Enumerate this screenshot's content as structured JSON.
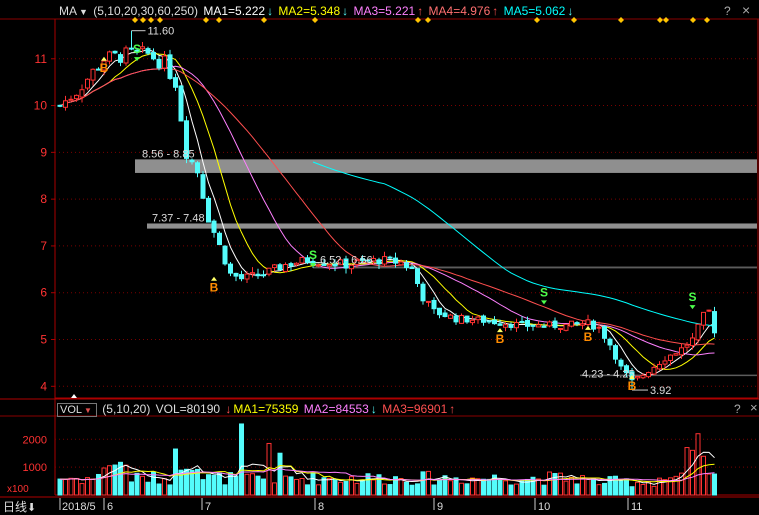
{
  "main_header": {
    "indicator": "MA",
    "dropdown": "▼",
    "params": "(5,10,20,30,60,250)",
    "ma1": "MA1=5.222",
    "ma1_arrow": "↓",
    "ma2": "MA2=5.348",
    "ma2_arrow": "↓",
    "ma3": "MA3=5.221",
    "ma3_arrow": "↑",
    "ma4": "MA4=4.976",
    "ma4_arrow": "↑",
    "ma5": "MA5=5.062",
    "ma5_arrow": "↓"
  },
  "vol_header": {
    "indicator": "VOL",
    "params": "(5,10,20)",
    "vol": "VOL=80190",
    "ma1": "MA1=75359",
    "ma1_arrow": "↓",
    "ma2": "MA2=84553",
    "ma2_arrow": "↓",
    "ma3": "MA3=96901",
    "ma3_arrow": "↑"
  },
  "window_buttons": {
    "help": "?",
    "close": "×"
  },
  "bottom_bar": {
    "period": "日线",
    "period_arrow": "⬇",
    "start_date": "2018/5"
  },
  "price_annotations": {
    "high": "11.60",
    "low": "3.92",
    "gap1": "8.56 - 8.85",
    "gap2": "7.37 - 7.48",
    "gap3": "6.52 - 6.56",
    "gap4": "4.23 - 4.25"
  },
  "signals": {
    "buy": "B",
    "sell": "S"
  },
  "vol_unit": "x100",
  "colors": {
    "up": "#ff3232",
    "down": "#54fcfc",
    "ma5": "#ffffff",
    "ma10": "#ffff00",
    "ma20": "#ff80ff",
    "ma30": "#ff4f4f",
    "ma60": "#00ffff",
    "grid": "#7a0000",
    "axis": "#aa0000",
    "buy": "#ff8c00",
    "sell": "#4cff4c",
    "diamond": "#ffc400",
    "gapband": "#a8a8a8"
  },
  "chart_data": {
    "type": "candlestick",
    "y_ticks": [
      "4",
      "5",
      "6",
      "7",
      "8",
      "9",
      "10",
      "11"
    ],
    "y_range": [
      3.75,
      11.85
    ],
    "vol_ticks": [
      "1000",
      "2000"
    ],
    "vol_range": [
      0,
      2800
    ],
    "x_ticks": [
      "6",
      "7",
      "8",
      "9",
      "10",
      "11"
    ],
    "first_date": "2018/5",
    "session_count": 120,
    "gaps": [
      [
        8.56,
        8.85
      ],
      [
        7.37,
        7.48
      ],
      [
        6.52,
        6.56
      ],
      [
        4.23,
        4.25
      ]
    ],
    "high": 11.6,
    "low": 3.92,
    "last_ma": {
      "MA5": 5.222,
      "MA10": 5.348,
      "MA20": 5.221,
      "MA30": 4.976,
      "MA60": 5.062
    },
    "last_vol_ma": {
      "MA1": 75359,
      "MA2": 84553,
      "MA3": 96901
    },
    "last_volume": 80190
  }
}
